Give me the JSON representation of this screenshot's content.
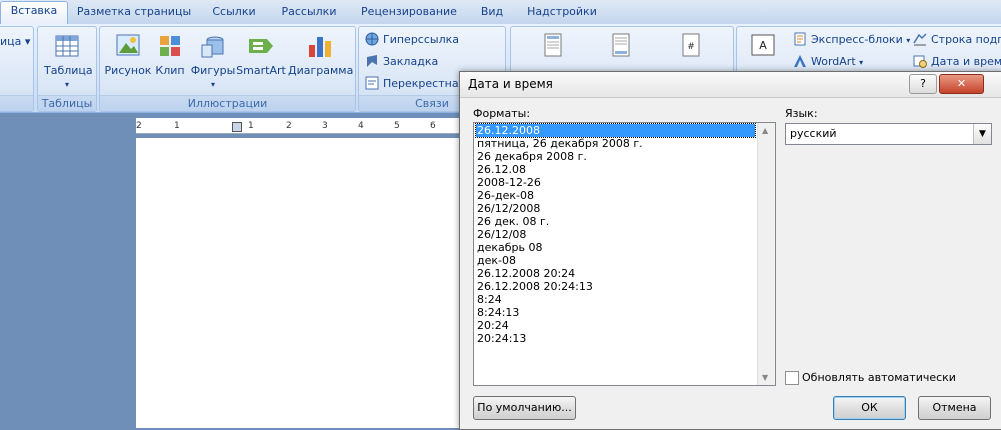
{
  "ribbon_tabs": [
    "Вставка",
    "Разметка страницы",
    "Ссылки",
    "Рассылки",
    "Рецензирование",
    "Вид",
    "Надстройки"
  ],
  "active_tab": "Вставка",
  "groups": {
    "tables": {
      "label": "Таблицы",
      "button": "Таблица",
      "partial_left": "ица"
    },
    "illustrations": {
      "label": "Иллюстрации",
      "buttons": [
        "Рисунок",
        "Клип",
        "Фигуры",
        "SmartArt",
        "Диаграмма"
      ]
    },
    "links": {
      "label": "Связи",
      "buttons": [
        "Гиперссылка",
        "Закладка",
        "Перекрестная"
      ]
    },
    "text": {
      "items": [
        "Экспресс-блоки",
        "Строка подпи",
        "WordArt",
        "Дата и время"
      ],
      "partial_button": "Надпись"
    }
  },
  "ruler_ticks": [
    "2",
    "1",
    "1",
    "2",
    "3",
    "4",
    "5",
    "6"
  ],
  "dialog": {
    "title": "Дата и время",
    "help_button": "?",
    "close_button": "✕",
    "formats_label": "Форматы:",
    "formats": [
      "26.12.2008",
      "пятница, 26 декабря 2008 г.",
      "26 декабря 2008 г.",
      "26.12.08",
      "2008-12-26",
      "26-дек-08",
      "26/12/2008",
      "26 дек. 08 г.",
      "26/12/08",
      "декабрь 08",
      "дек-08",
      "26.12.2008 20:24",
      "26.12.2008 20:24:13",
      "8:24",
      "8:24:13",
      "20:24",
      "20:24:13"
    ],
    "selected_index": 0,
    "language_label": "Язык:",
    "language_value": "русский",
    "auto_update_label": "Обновлять автоматически",
    "auto_update_checked": false,
    "default_button": "По умолчанию...",
    "ok_button": "ОК",
    "cancel_button": "Отмена"
  }
}
